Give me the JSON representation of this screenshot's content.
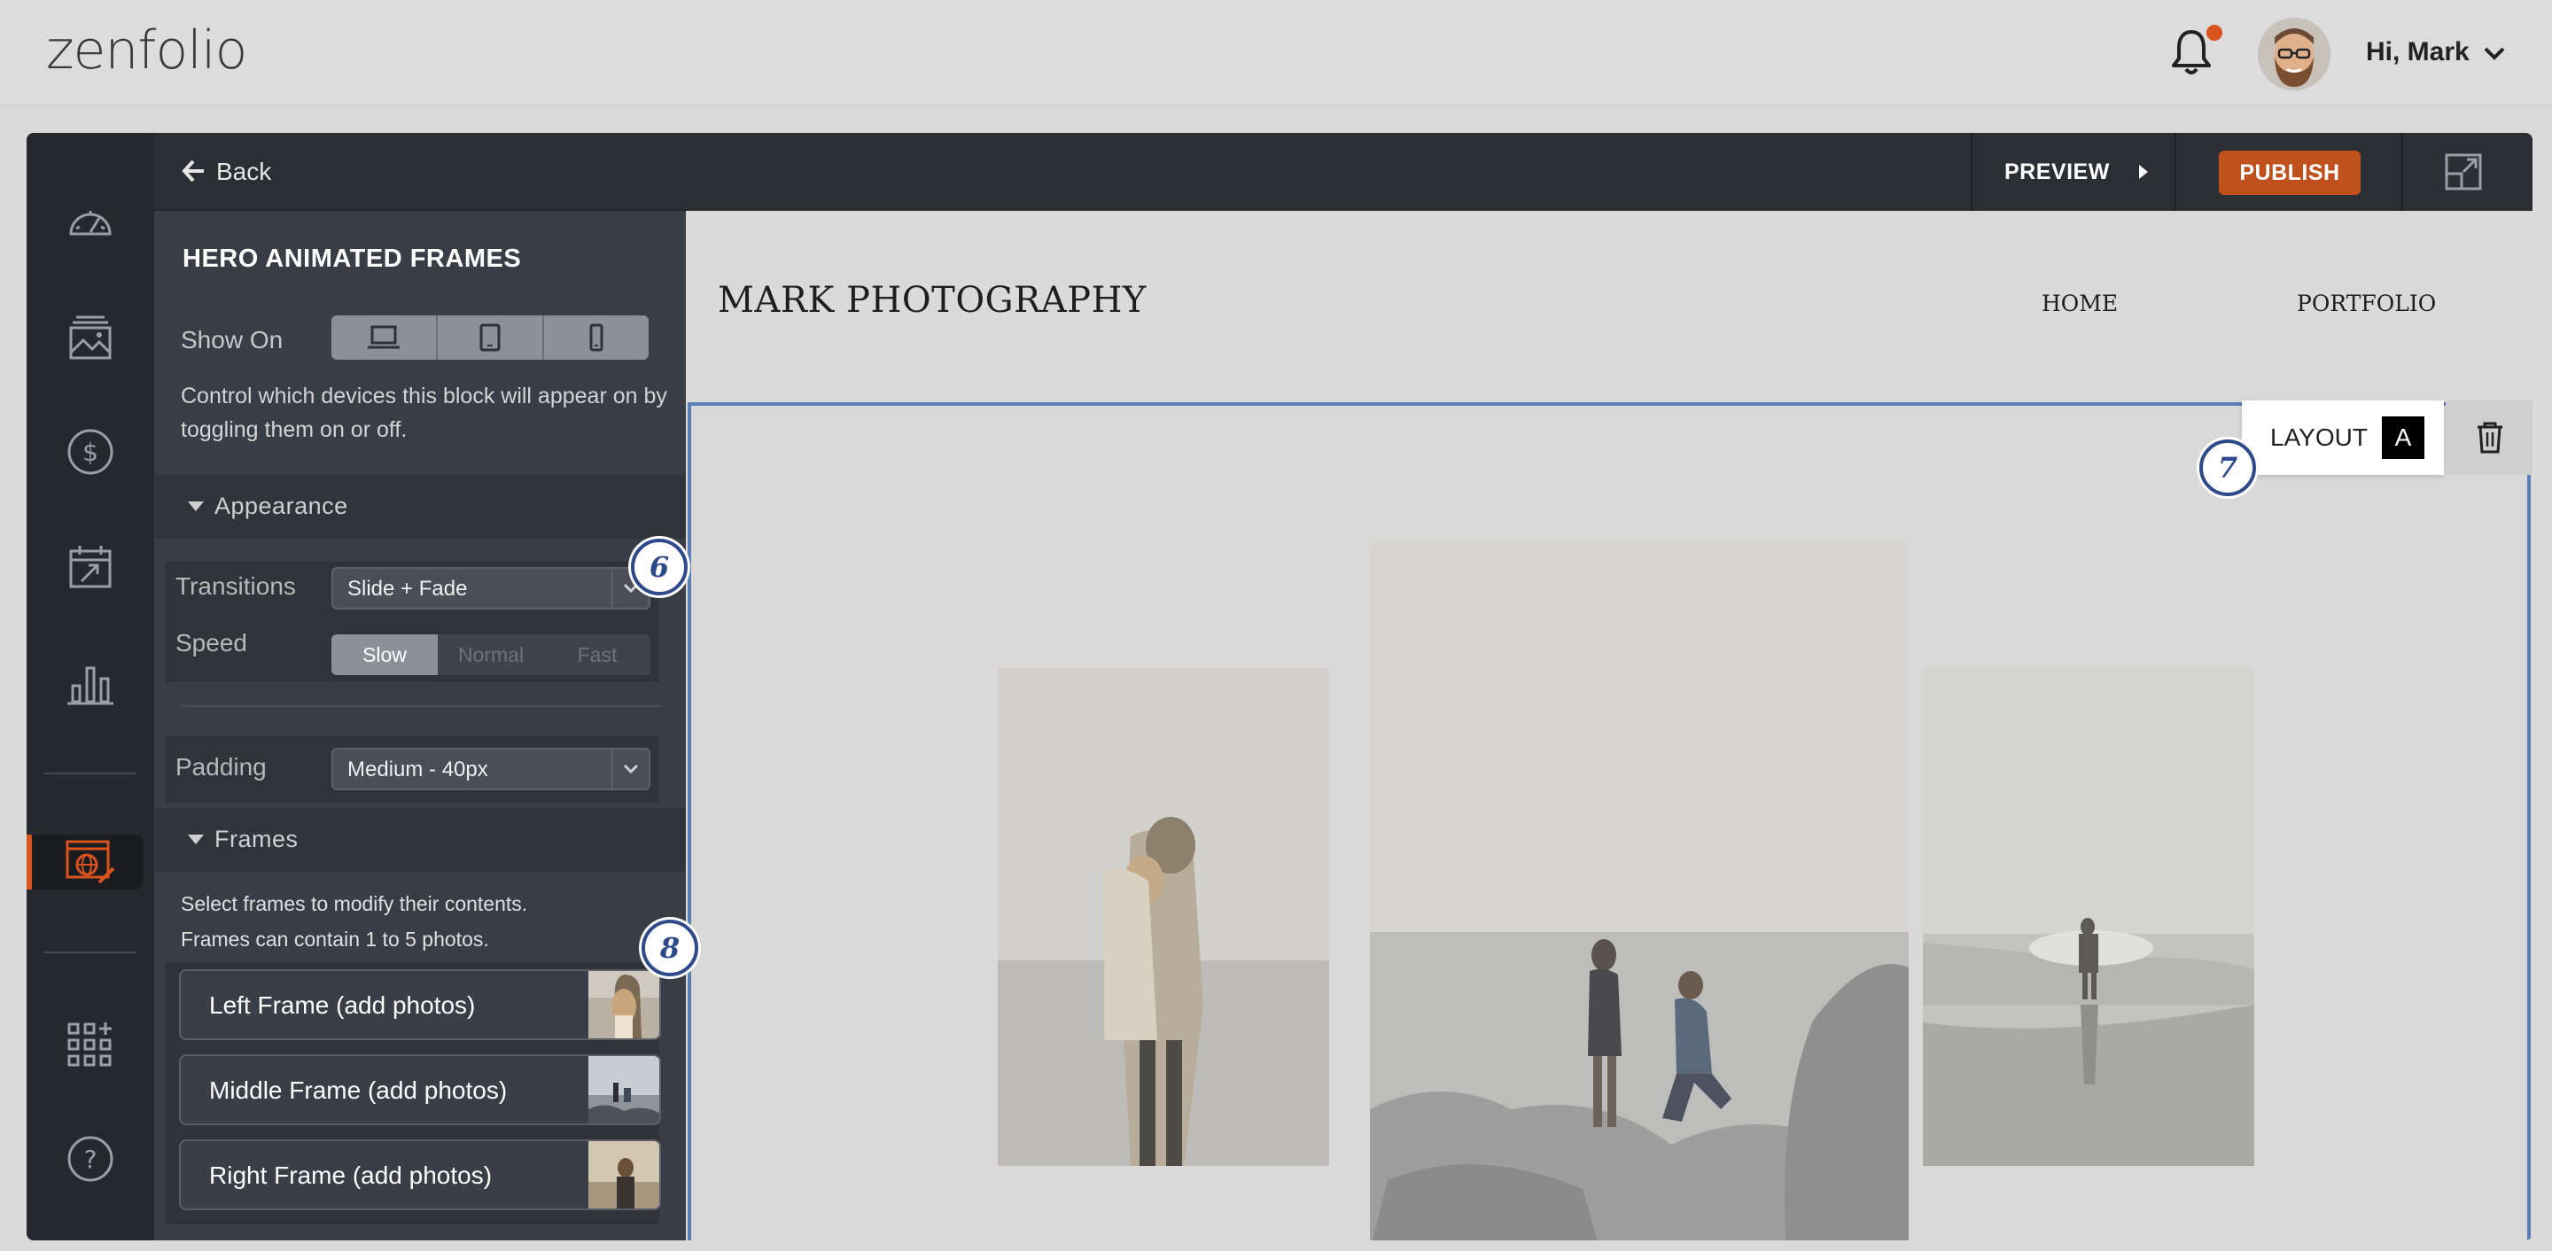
{
  "brand": {
    "logo_text": "zenfolio",
    "accent": "#d9531e"
  },
  "user": {
    "greeting": "Hi, Mark"
  },
  "panel": {
    "back_label": "Back",
    "block_title": "HERO ANIMATED FRAMES",
    "show_on_label": "Show On",
    "show_on_help": "Control which devices this block will appear on by toggling them on or off.",
    "appearance": {
      "heading": "Appearance",
      "transitions_label": "Transitions",
      "transitions_value": "Slide + Fade",
      "speed_label": "Speed",
      "speed_options": [
        "Slow",
        "Normal",
        "Fast"
      ],
      "speed_selected": "Slow",
      "padding_label": "Padding",
      "padding_value": "Medium - 40px"
    },
    "frames": {
      "heading": "Frames",
      "help_line1": "Select frames to modify their contents.",
      "help_line2": "Frames can contain 1 to 5 photos.",
      "items": [
        {
          "label": "Left Frame (add photos)"
        },
        {
          "label": "Middle Frame (add photos)"
        },
        {
          "label": "Right Frame (add photos)"
        }
      ]
    }
  },
  "badges": {
    "b6": "6",
    "b7": "7",
    "b8": "8"
  },
  "editor": {
    "preview_label": "PREVIEW",
    "publish_label": "PUBLISH"
  },
  "site": {
    "title": "MARK PHOTOGRAPHY",
    "nav": [
      "HOME",
      "PORTFOLIO"
    ],
    "layout_label": "LAYOUT",
    "layout_letter": "A"
  },
  "rail_icons": [
    "dashboard-icon",
    "gallery-icon",
    "dollar-icon",
    "calendar-icon",
    "stats-icon",
    "website-editor-icon",
    "apps-icon",
    "help-icon"
  ]
}
